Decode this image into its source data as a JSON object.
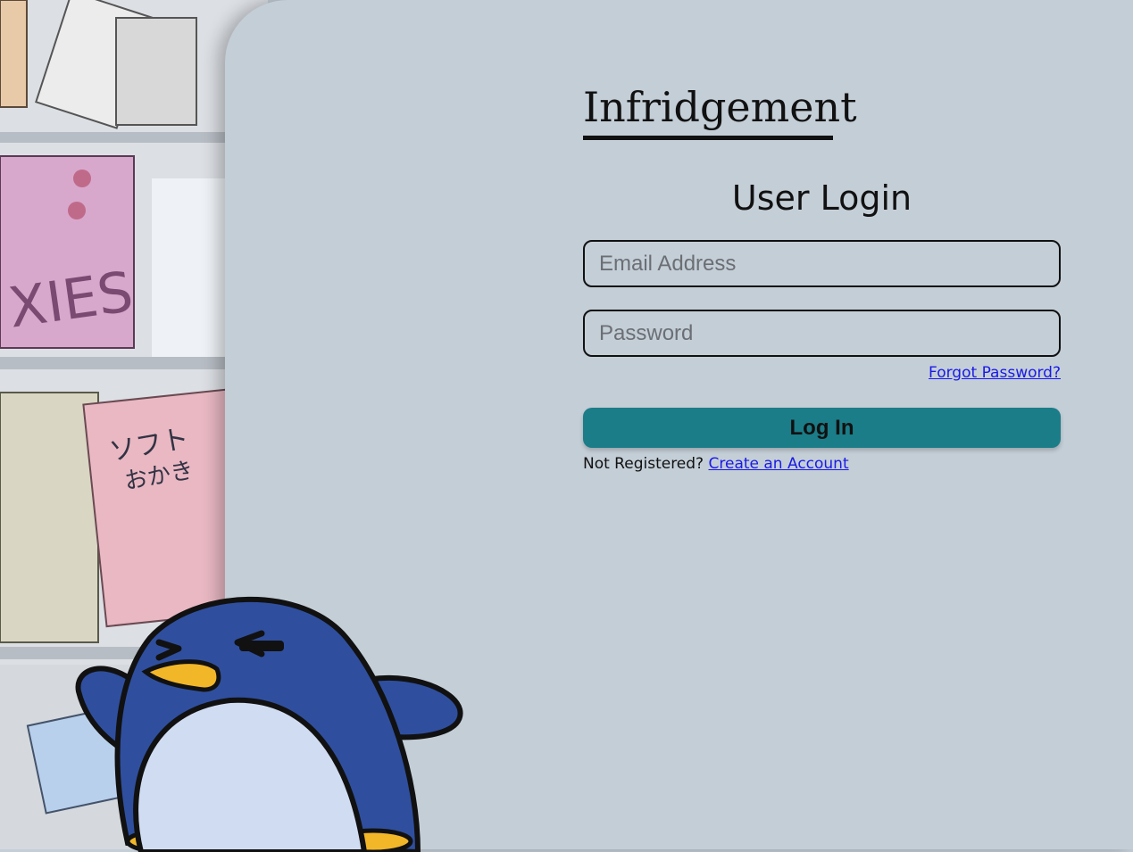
{
  "app": {
    "title": "Infridgement"
  },
  "login": {
    "heading": "User Login",
    "email_placeholder": "Email Address",
    "password_placeholder": "Password",
    "forgot_label": "Forgot Password?",
    "submit_label": "Log In",
    "register_prompt": "Not Registered?",
    "register_link": "Create an Account"
  },
  "colors": {
    "panel_bg": "#c4ced7",
    "button_bg": "#1b7d88",
    "link": "#1a1ae6",
    "penguin_body": "#2f4f9e",
    "penguin_belly": "#d0dcf2",
    "penguin_beak": "#f2b629"
  },
  "icons": {
    "mascot": "penguin-mascot-icon",
    "background": "fridge-illustration"
  }
}
